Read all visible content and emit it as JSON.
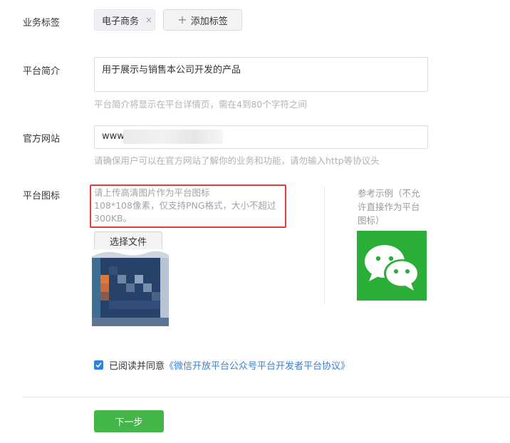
{
  "tags": {
    "label": "业务标签",
    "items": [
      {
        "text": "电子商务",
        "remove": "×"
      }
    ],
    "add_label": "添加标签"
  },
  "intro": {
    "label": "平台简介",
    "value": "用于展示与销售本公司开发的产品",
    "hint": "平台简介将显示在平台详情页，需在4到80个字符之间"
  },
  "website": {
    "label": "官方网站",
    "value": "www.",
    "hint": "请确保用户可以在官方网站了解你的业务和功能，请勿输入http等协议头"
  },
  "icon": {
    "label": "平台图标",
    "requirement_line1": "请上传高清图片作为平台图标",
    "requirement_line2": "108*108像素，仅支持PNG格式，大小不超过300KB。",
    "choose_file": "选择文件",
    "reference_text": "参考示例（不允许直接作为平台图标）",
    "reference_icon": "wechat-logo-icon"
  },
  "agreement": {
    "prefix": "已阅读并同意",
    "link": "《微信开放平台公众号平台开发者平台协议》",
    "checked": true
  },
  "next_label": "下一步",
  "colors": {
    "primary_green": "#44b549",
    "wechat_green": "#2aae38",
    "link_blue": "#3a7fd5",
    "highlight_red": "#e03c3c"
  }
}
